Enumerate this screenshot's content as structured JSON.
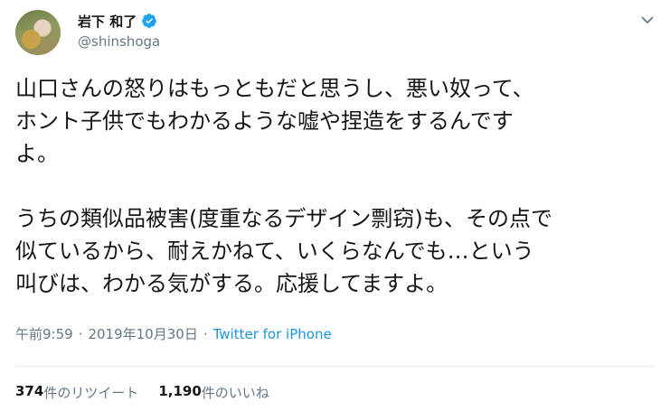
{
  "author": {
    "display_name": "岩下 和了",
    "handle": "@shinshoga"
  },
  "tweet": {
    "text": "山口さんの怒りはもっともだと思うし、悪い奴って、\nホント子供でもわかるような嘘や捏造をするんです\nよ。\n\nうちの類似品被害(度重なるデザイン剽窃)も、その点で\n似ているから、耐えかねて、いくらなんでも…という\n叫びは、わかる気がする。応援してますよ。",
    "time": "午前9:59",
    "date": "2019年10月30日",
    "separator": "·",
    "source": "Twitter for iPhone"
  },
  "stats": {
    "retweets_count": "374",
    "retweets_label": "件のリツイート",
    "likes_count": "1,190",
    "likes_label": "件のいいね"
  },
  "colors": {
    "verified": "#1da1f2",
    "link": "#1b95e0",
    "muted": "#657786"
  }
}
